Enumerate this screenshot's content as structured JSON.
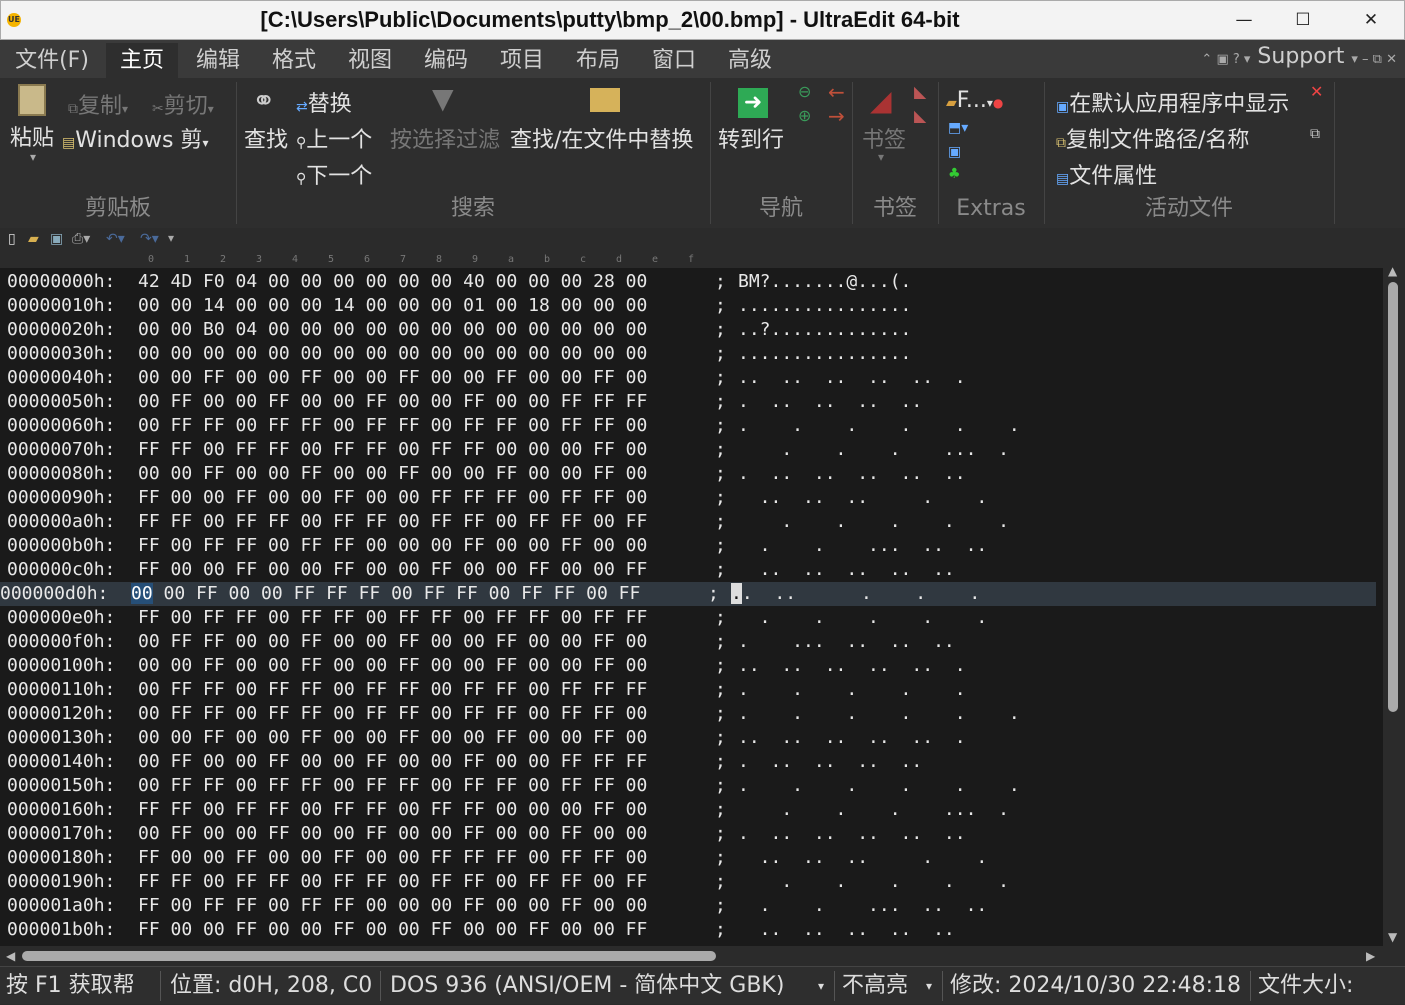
{
  "window": {
    "title": "[C:\\Users\\Public\\Documents\\putty\\bmp_2\\00.bmp] - UltraEdit 64-bit",
    "minimize": "—",
    "maximize": "☐",
    "close": "✕"
  },
  "menu": {
    "tabs": [
      "文件(F)",
      "主页",
      "编辑",
      "格式",
      "视图",
      "编码",
      "项目",
      "布局",
      "窗口",
      "高级"
    ],
    "active": "主页",
    "support": "Support"
  },
  "ribbon": {
    "clipboard": {
      "paste": "粘贴",
      "copy": "复制",
      "cut": "剪切",
      "windows": "Windows 剪",
      "label": "剪贴板"
    },
    "search": {
      "find": "查找",
      "replace": "替换",
      "prev": "上一个",
      "next": "下一个",
      "filter": "按选择过滤",
      "find_in_files": "查找/在文件中替换",
      "label": "搜索"
    },
    "navigation": {
      "goto": "转到行",
      "label": "导航"
    },
    "bookmarks": {
      "bookmark": "书签",
      "label": "书签"
    },
    "extras": {
      "item": "F...",
      "label": "Extras"
    },
    "active_file": {
      "open_default": "在默认应用程序中显示",
      "copy_path": "复制文件路径/名称",
      "properties": "文件属性",
      "label": "活动文件"
    }
  },
  "ruler": [
    "0",
    "1",
    "2",
    "3",
    "4",
    "5",
    "6",
    "7",
    "8",
    "9",
    "a",
    "b",
    "c",
    "d",
    "e",
    "f"
  ],
  "hex": {
    "rows": [
      {
        "addr": "00000000h:",
        "hex": "42 4D F0 04 00 00 00 00 00 00 40 00 00 00 28 00",
        "asc": "BM?.......@...(."
      },
      {
        "addr": "00000010h:",
        "hex": "00 00 14 00 00 00 14 00 00 00 01 00 18 00 00 00",
        "asc": "................"
      },
      {
        "addr": "00000020h:",
        "hex": "00 00 B0 04 00 00 00 00 00 00 00 00 00 00 00 00",
        "asc": "..?............."
      },
      {
        "addr": "00000030h:",
        "hex": "00 00 00 00 00 00 00 00 00 00 00 00 00 00 00 00",
        "asc": "................"
      },
      {
        "addr": "00000040h:",
        "hex": "00 00 FF 00 00 FF 00 00 FF 00 00 FF 00 00 FF 00",
        "asc": "..  ..  ..  ..  ..  ."
      },
      {
        "addr": "00000050h:",
        "hex": "00 FF 00 00 FF 00 00 FF 00 00 FF 00 00 FF FF FF",
        "asc": ".  ..  ..  ..  .."
      },
      {
        "addr": "00000060h:",
        "hex": "00 FF FF 00 FF FF 00 FF FF 00 FF FF 00 FF FF 00",
        "asc": ".    .    .    .    .    ."
      },
      {
        "addr": "00000070h:",
        "hex": "FF FF 00 FF FF 00 FF FF 00 FF FF 00 00 00 FF 00",
        "asc": "    .    .    .    ...  ."
      },
      {
        "addr": "00000080h:",
        "hex": "00 00 FF 00 00 FF 00 00 FF 00 00 FF 00 00 FF 00",
        "asc": ".  ..  ..  ..  ..  .."
      },
      {
        "addr": "00000090h:",
        "hex": "FF 00 00 FF 00 00 FF 00 00 FF FF FF 00 FF FF 00",
        "asc": "  ..  ..  ..     .    ."
      },
      {
        "addr": "000000a0h:",
        "hex": "FF FF 00 FF FF 00 FF FF 00 FF FF 00 FF FF 00 FF",
        "asc": "    .    .    .    .    ."
      },
      {
        "addr": "000000b0h:",
        "hex": "FF 00 FF FF 00 FF FF 00 00 00 FF 00 00 FF 00 00",
        "asc": "  .    .    ...  ..  .."
      },
      {
        "addr": "000000c0h:",
        "hex": "FF 00 00 FF 00 00 FF 00 00 FF 00 00 FF 00 00 FF",
        "asc": "  ..  ..  ..  ..  .."
      },
      {
        "addr": "000000d0h:",
        "hex": "00 00 FF 00 00 FF FF FF 00 FF FF 00 FF FF 00 FF",
        "asc": "..  ..      .    .    ."
      },
      {
        "addr": "000000e0h:",
        "hex": "FF 00 FF FF 00 FF FF 00 FF FF 00 FF FF 00 FF FF",
        "asc": "  .    .    .    .    ."
      },
      {
        "addr": "000000f0h:",
        "hex": "00 FF FF 00 00 FF 00 00 FF 00 00 FF 00 00 FF 00",
        "asc": ".    ...  ..  ..  .."
      },
      {
        "addr": "00000100h:",
        "hex": "00 00 FF 00 00 FF 00 00 FF 00 00 FF 00 00 FF 00",
        "asc": "..  ..  ..  ..  ..  ."
      },
      {
        "addr": "00000110h:",
        "hex": "00 FF FF 00 FF FF 00 FF FF 00 FF FF 00 FF FF FF",
        "asc": ".    .    .    .    ."
      },
      {
        "addr": "00000120h:",
        "hex": "00 FF FF 00 FF FF 00 FF FF 00 FF FF 00 FF FF 00",
        "asc": ".    .    .    .    .    ."
      },
      {
        "addr": "00000130h:",
        "hex": "00 00 FF 00 00 FF 00 00 FF 00 00 FF 00 00 FF 00",
        "asc": "..  ..  ..  ..  ..  ."
      },
      {
        "addr": "00000140h:",
        "hex": "00 FF 00 00 FF 00 00 FF 00 00 FF 00 00 FF FF FF",
        "asc": ".  ..  ..  ..  .."
      },
      {
        "addr": "00000150h:",
        "hex": "00 FF FF 00 FF FF 00 FF FF 00 FF FF 00 FF FF 00",
        "asc": ".    .    .    .    .    ."
      },
      {
        "addr": "00000160h:",
        "hex": "FF FF 00 FF FF 00 FF FF 00 FF FF 00 00 00 FF 00",
        "asc": "    .    .    .    ...  ."
      },
      {
        "addr": "00000170h:",
        "hex": "00 FF 00 00 FF 00 00 FF 00 00 FF 00 00 FF 00 00",
        "asc": ".  ..  ..  ..  ..  .."
      },
      {
        "addr": "00000180h:",
        "hex": "FF 00 00 FF 00 00 FF 00 00 FF FF FF 00 FF FF 00",
        "asc": "  ..  ..  ..     .    ."
      },
      {
        "addr": "00000190h:",
        "hex": "FF FF 00 FF FF 00 FF FF 00 FF FF 00 FF FF 00 FF",
        "asc": "    .    .    .    .    ."
      },
      {
        "addr": "000001a0h:",
        "hex": "FF 00 FF FF 00 FF FF 00 00 00 FF 00 00 FF 00 00",
        "asc": "  .    .    ...  ..  .."
      },
      {
        "addr": "000001b0h:",
        "hex": "FF 00 00 FF 00 00 FF 00 00 FF 00 00 FF 00 00 FF",
        "asc": "  ..  ..  ..  ..  .."
      }
    ],
    "cursor_row": 13
  },
  "status": {
    "help": "按 F1 获取帮",
    "position": "位置: d0H, 208, C0",
    "encoding": "DOS 936   (ANSI/OEM - 简体中文 GBK)",
    "highlight": "不高亮",
    "modified": "修改:   2024/10/30 22:48:18",
    "filesize": "文件大小:"
  },
  "colors": {
    "accent": "#264f78",
    "bg": "#1a1a1a",
    "chrome": "#2e2e2e"
  }
}
